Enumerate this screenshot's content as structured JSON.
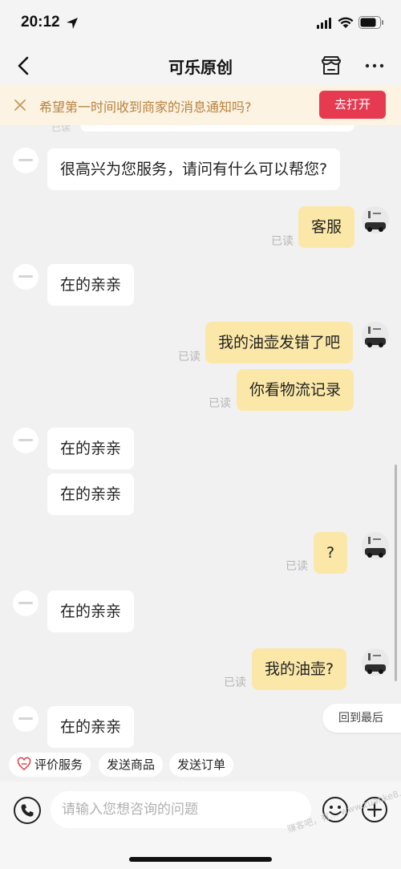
{
  "status": {
    "time": "20:12"
  },
  "nav": {
    "title": "可乐原创"
  },
  "notice": {
    "text": "希望第一时间收到商家的消息通知吗?",
    "button": "去打开"
  },
  "chat": {
    "read_label": "已读",
    "partial_read": "已读",
    "messages": [
      {
        "side": "in",
        "text": "很高兴为您服务，请问有什么可以帮您?"
      },
      {
        "side": "out",
        "text": "客服",
        "read": "已读"
      },
      {
        "side": "in",
        "text": "在的亲亲"
      },
      {
        "side": "out",
        "text": "我的油壶发错了吧",
        "read": "已读"
      },
      {
        "side": "out",
        "text": "你看物流记录",
        "read": "已读"
      },
      {
        "side": "in",
        "text": "在的亲亲"
      },
      {
        "side": "in",
        "text": "在的亲亲"
      },
      {
        "side": "out",
        "text": "?",
        "read": "已读"
      },
      {
        "side": "in",
        "text": "在的亲亲"
      },
      {
        "side": "out",
        "text": "我的油壶?",
        "read": "已读"
      },
      {
        "side": "in",
        "text": "在的亲亲"
      }
    ],
    "back_to_bottom": "回到最后"
  },
  "quick_actions": [
    "评价服务",
    "发送商品",
    "发送订单"
  ],
  "input": {
    "placeholder": "请输入您想咨询的问题"
  },
  "watermark": "赚客吧，有… www.zuanke8.com",
  "colors": {
    "notice_button": "#e63a50",
    "outgoing_bubble": "#fbe8a8",
    "notice_text": "#b7833f"
  }
}
